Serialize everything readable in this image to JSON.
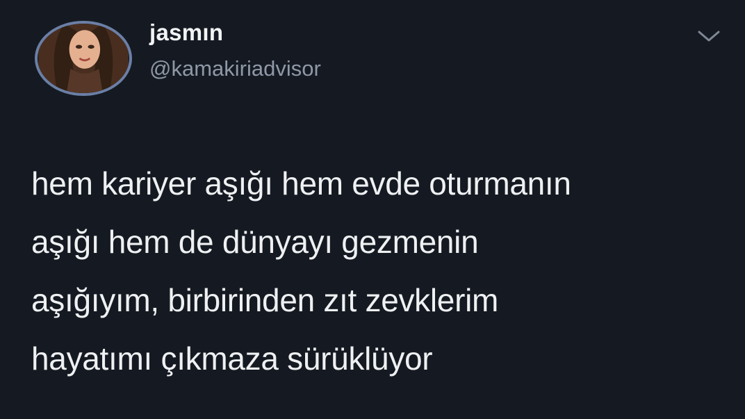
{
  "author": {
    "display_name": "jasmın",
    "handle": "@kamakiriadvisor",
    "avatar_icon": "profile-avatar"
  },
  "header": {
    "more_icon": "chevron-down-icon"
  },
  "tweet": {
    "text": "hem kariyer aşığı hem evde oturmanın\naşığı hem de dünyayı gezmenin\naşığıyım, birbirinden zıt zevklerim\nhayatımı çıkmaza sürüklüyor"
  },
  "colors": {
    "background": "#151a22",
    "text": "#eef0f2",
    "muted": "#8f98a6",
    "avatar_ring": "#6b7fa6"
  }
}
